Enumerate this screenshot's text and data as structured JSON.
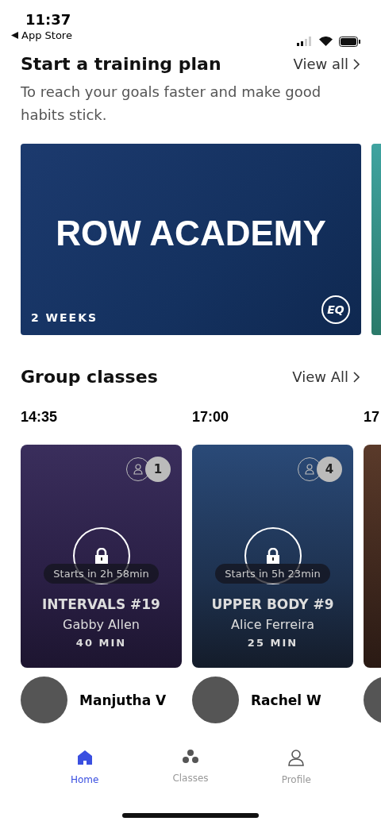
{
  "status_bar": {
    "time": "11:37",
    "back_label": "App Store"
  },
  "training": {
    "title": "Start a training plan",
    "view_all": "View all",
    "subtitle": "To reach your goals faster and make good habits stick.",
    "plans": [
      {
        "title": "ROW ACADEMY",
        "duration": "2 WEEKS",
        "badge": "EQ"
      }
    ]
  },
  "group_classes": {
    "title": "Group classes",
    "view_all": "View All",
    "classes": [
      {
        "time": "14:35",
        "participants": "1",
        "starts_in": "Starts in 2h 58min",
        "title": "INTERVALS #19",
        "instructor": "Gabby Allen",
        "duration": "40 MIN",
        "host": "Manjutha V"
      },
      {
        "time": "17:00",
        "participants": "4",
        "starts_in": "Starts in 5h 23min",
        "title": "UPPER BODY #9",
        "instructor": "Alice Ferreira",
        "duration": "25 MIN",
        "host": "Rachel W"
      },
      {
        "time": "17"
      }
    ]
  },
  "tabs": [
    {
      "label": "Home",
      "selected": true,
      "kind": "home"
    },
    {
      "label": "Classes",
      "selected": false,
      "kind": "classes"
    },
    {
      "label": "Profile",
      "selected": false,
      "kind": "profile"
    }
  ]
}
